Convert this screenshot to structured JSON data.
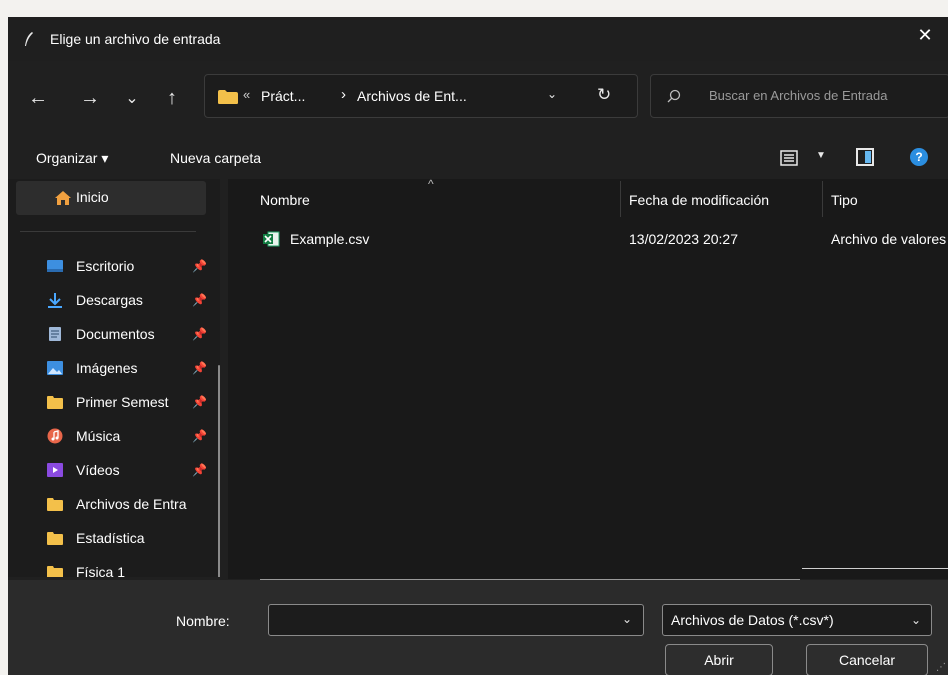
{
  "window": {
    "title": "Elige un archivo de entrada",
    "close": "✕"
  },
  "nav": {
    "back": "←",
    "forward": "→",
    "recent": "⌄",
    "up": "↑"
  },
  "address": {
    "sep1": "«",
    "crumb1": "Práct...",
    "sep2": "›",
    "crumb2": "Archivos de Ent...",
    "dropdown": "⌄",
    "refresh": "↻"
  },
  "search": {
    "placeholder": "Buscar en Archivos de Entrada"
  },
  "toolbar": {
    "organize": "Organizar ▾",
    "new_folder": "Nueva carpeta",
    "view_drop": "▼",
    "help": "?"
  },
  "sidebar": {
    "home": {
      "label": "Inicio",
      "icon": "home-icon"
    },
    "items": [
      {
        "label": "Escritorio",
        "icon": "desktop-icon",
        "pin": "📌",
        "color": "#3d8fe0"
      },
      {
        "label": "Descargas",
        "icon": "download-icon",
        "pin": "📌",
        "color": "#4aa8ff"
      },
      {
        "label": "Documentos",
        "icon": "document-icon",
        "pin": "📌",
        "color": "#9fb8d8"
      },
      {
        "label": "Imágenes",
        "icon": "image-icon",
        "pin": "📌",
        "color": "#3d8fe0"
      },
      {
        "label": "Primer Semest",
        "icon": "folder-icon",
        "pin": "📌",
        "color": "#f3c04a"
      },
      {
        "label": "Música",
        "icon": "music-icon",
        "pin": "📌",
        "color": "#e8664a"
      },
      {
        "label": "Vídeos",
        "icon": "video-icon",
        "pin": "📌",
        "color": "#8a4ae0"
      },
      {
        "label": "Archivos de Entra",
        "icon": "folder-icon",
        "pin": "",
        "color": "#f3c04a"
      },
      {
        "label": "Estadística",
        "icon": "folder-icon",
        "pin": "",
        "color": "#f3c04a"
      },
      {
        "label": "Física 1",
        "icon": "folder-icon",
        "pin": "",
        "color": "#f3c04a"
      }
    ]
  },
  "filelist": {
    "columns": {
      "name": "Nombre",
      "date": "Fecha de modificación",
      "type": "Tipo"
    },
    "sort_arrow": "^",
    "rows": [
      {
        "name": "Example.csv",
        "date": "13/02/2023 20:27",
        "type": "Archivo de valores separados por comas"
      }
    ]
  },
  "bottom": {
    "name_label": "Nombre:",
    "name_value": "",
    "name_drop": "⌄",
    "filter": "Archivos de Datos (*.csv*)",
    "filter_drop": "⌄",
    "open": "Abrir",
    "cancel": "Cancelar"
  },
  "colors": {
    "accent": "#2b8ee0",
    "folder": "#f3c04a",
    "background": "#202020"
  }
}
